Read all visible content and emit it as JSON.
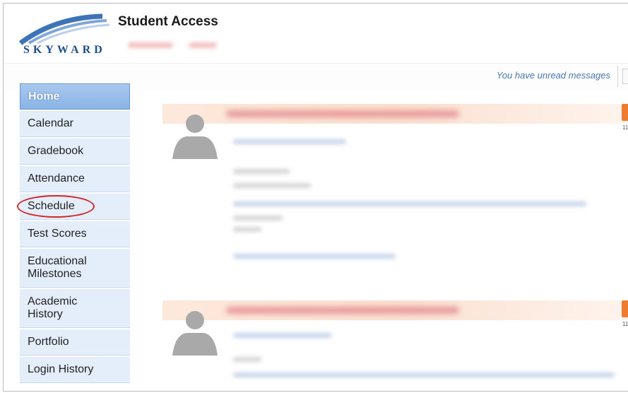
{
  "header": {
    "logo_text": "SKYWARD",
    "title": "Student Access"
  },
  "messages": {
    "unread_text": "You have unread messages"
  },
  "sidebar": {
    "items": [
      {
        "label": "Home"
      },
      {
        "label": "Calendar"
      },
      {
        "label": "Gradebook"
      },
      {
        "label": "Attendance"
      },
      {
        "label": "Schedule"
      },
      {
        "label": "Test Scores"
      },
      {
        "label": "Educational",
        "label2": "Milestones"
      },
      {
        "label": "Academic",
        "label2": "History"
      },
      {
        "label": "Portfolio"
      },
      {
        "label": "Login History"
      }
    ]
  },
  "posts": [
    {
      "icon_count": "11"
    },
    {
      "icon_count": "11"
    }
  ],
  "colors": {
    "nav_bg": "#e4eefa",
    "nav_active": "#8ab4e6",
    "accent_blue": "#4a78b0",
    "highlight_circle": "#d0262a",
    "post_icon": "#ee7b2e"
  }
}
